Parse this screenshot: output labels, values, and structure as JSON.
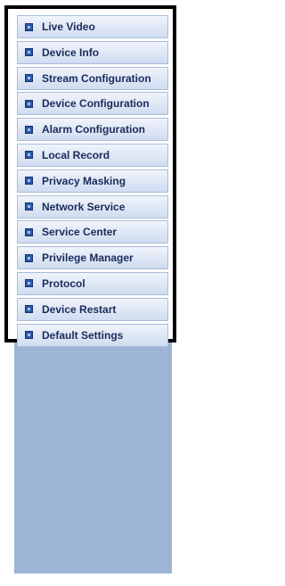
{
  "menu": {
    "items": [
      {
        "label": "Live Video",
        "icon": "menu-square-icon"
      },
      {
        "label": "Device Info",
        "icon": "menu-square-icon"
      },
      {
        "label": "Stream Configuration",
        "icon": "menu-square-icon"
      },
      {
        "label": "Device Configuration",
        "icon": "menu-square-icon"
      },
      {
        "label": "Alarm Configuration",
        "icon": "menu-square-icon"
      },
      {
        "label": "Local Record",
        "icon": "menu-square-icon"
      },
      {
        "label": "Privacy Masking",
        "icon": "menu-square-icon"
      },
      {
        "label": "Network Service",
        "icon": "menu-square-icon"
      },
      {
        "label": "Service Center",
        "icon": "menu-square-icon"
      },
      {
        "label": "Privilege Manager",
        "icon": "menu-square-icon"
      },
      {
        "label": "Protocol",
        "icon": "menu-square-icon"
      },
      {
        "label": "Device Restart",
        "icon": "menu-square-icon"
      },
      {
        "label": "Default Settings",
        "icon": "menu-square-icon"
      }
    ]
  },
  "colors": {
    "sidebar_background": "#9db4d6",
    "item_text": "#1a2c5b",
    "frame_border": "#000000",
    "icon_fill": "#2b58a8"
  }
}
